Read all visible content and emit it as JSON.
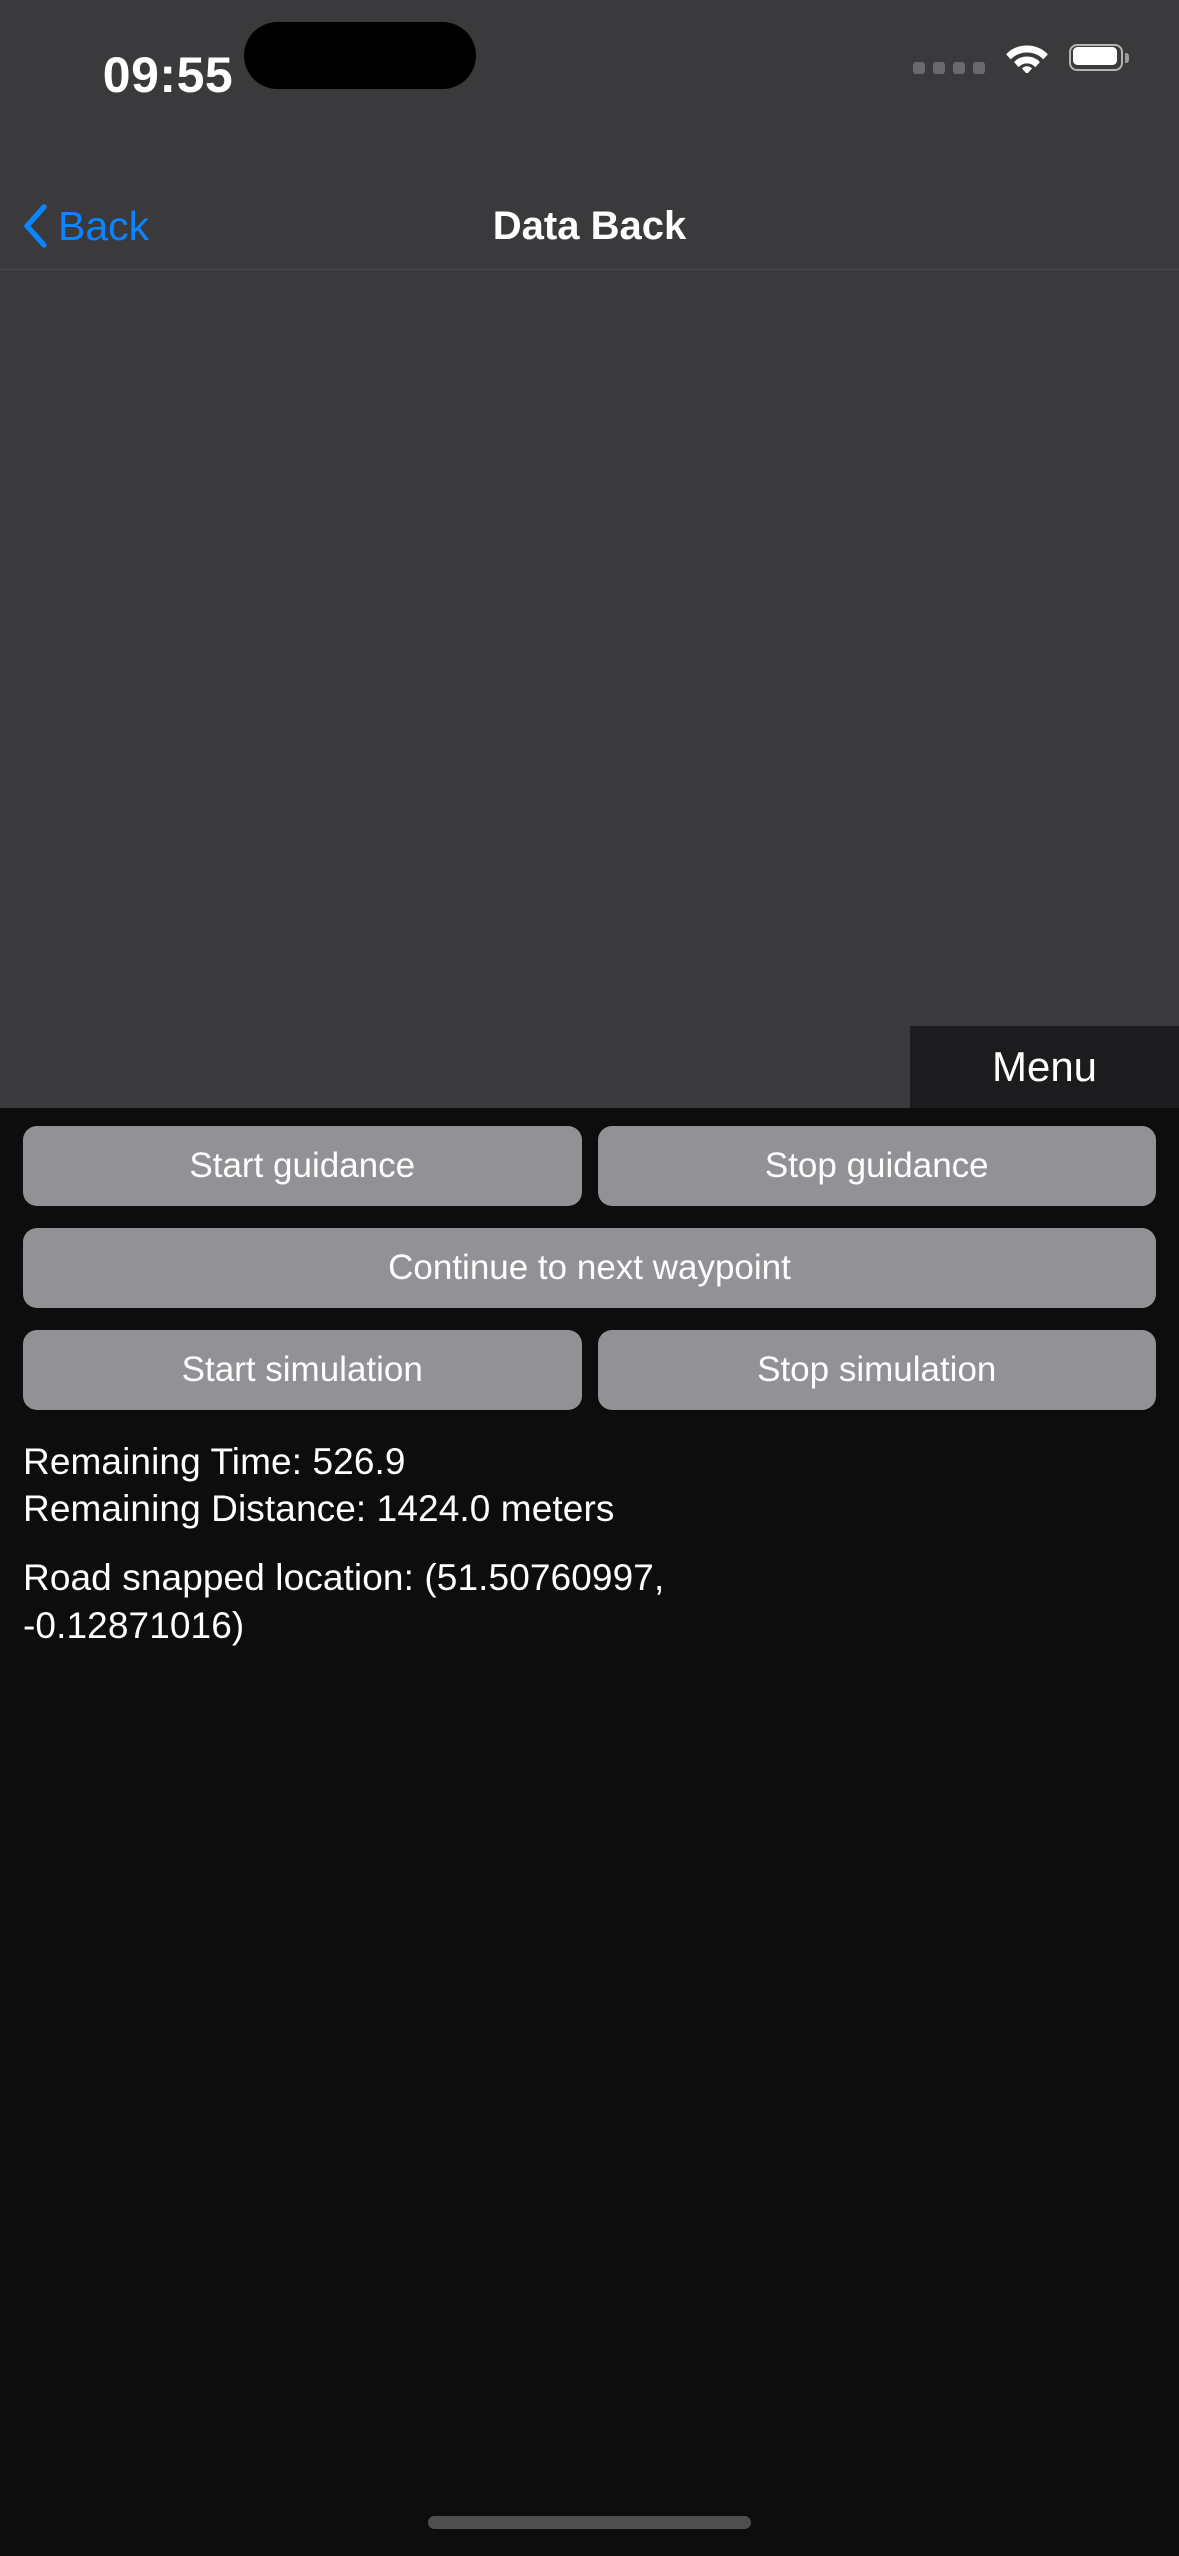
{
  "status_bar": {
    "time": "09:55",
    "cellular_icon": "cellular-dots-icon",
    "wifi_icon": "wifi-icon",
    "battery_icon": "battery-full-icon",
    "dynamic_island": "dynamic-island"
  },
  "nav_bar": {
    "back_label": "Back",
    "back_icon": "chevron-left-icon",
    "title": "Data Back"
  },
  "map": {
    "menu_label": "Menu"
  },
  "controls": {
    "rows": [
      [
        {
          "label": "Start guidance",
          "name": "start-guidance-button"
        },
        {
          "label": "Stop guidance",
          "name": "stop-guidance-button"
        }
      ],
      [
        {
          "label": "Continue to next waypoint",
          "name": "continue-next-waypoint-button"
        }
      ],
      [
        {
          "label": "Start simulation",
          "name": "start-simulation-button"
        },
        {
          "label": "Stop simulation",
          "name": "stop-simulation-button"
        }
      ]
    ],
    "start_guidance": "Start guidance",
    "stop_guidance": "Stop guidance",
    "continue_waypoint": "Continue to next waypoint",
    "start_simulation": "Start simulation",
    "stop_simulation": "Stop simulation"
  },
  "info": {
    "remaining_time": "Remaining Time: 526.9",
    "remaining_distance": "Remaining Distance: 1424.0 meters",
    "road_snapped_line1": "Road snapped location: (51.50760997,",
    "road_snapped_line2": "-0.12871016)"
  },
  "colors": {
    "accent_blue": "#0a84ff",
    "button_gray": "#929296",
    "map_background": "#3a3a3c",
    "panel_background": "#0d0d0d",
    "menu_background": "#1c1c1e"
  }
}
